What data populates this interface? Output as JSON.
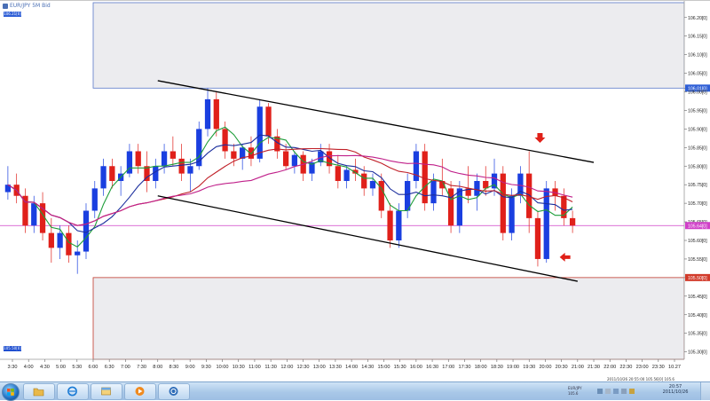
{
  "window": {
    "title": "EUR/JPY 5M Bid",
    "badge_top": "106.21[0]",
    "badge_bottom": "105.50[0]"
  },
  "chart_data": {
    "type": "candlestick",
    "symbol": "EUR/JPY",
    "yticks": [
      "106.20[0]",
      "106.15[0]",
      "106.10[0]",
      "106.05[0]",
      "106.01[0]",
      "106.00[0]",
      "105.95[0]",
      "105.90[0]",
      "105.85[0]",
      "105.80[0]",
      "105.75[0]",
      "105.70[0]",
      "105.65[0]",
      "105.60[0]",
      "105.55[0]",
      "105.50[0]",
      "105.45[0]",
      "105.40[0]",
      "105.35[0]",
      "105.30[0]"
    ],
    "yvalues": [
      106.2,
      106.15,
      106.1,
      106.05,
      106.01,
      106.0,
      105.95,
      105.9,
      105.85,
      105.8,
      105.75,
      105.7,
      105.65,
      105.6,
      105.55,
      105.5,
      105.45,
      105.4,
      105.35,
      105.3
    ],
    "ylim": [
      105.28,
      106.24
    ],
    "xticks": [
      "3:30",
      "4:00",
      "4:30",
      "5:00",
      "5:30",
      "6:00",
      "6:30",
      "7:00",
      "7:30",
      "8:00",
      "8:30",
      "9:00",
      "9:30",
      "10:00",
      "10:30",
      "11:00",
      "11:30",
      "12:00",
      "12:30",
      "13:00",
      "13:30",
      "14:00",
      "14:30",
      "15:00",
      "15:30",
      "16:00",
      "16:30",
      "17:00",
      "17:30",
      "18:00",
      "18:30",
      "19:00",
      "19:30",
      "20:00",
      "20:30",
      "21:00",
      "21:30",
      "22:00",
      "22:30",
      "23:00",
      "23:30",
      "10.27"
    ],
    "current_price": "105.64[0]",
    "current_value": 105.64,
    "top_level": 106.01,
    "bottom_level": 105.5,
    "trend_channel": {
      "upper": {
        "start": [
          "8:00",
          106.03
        ],
        "end": [
          "21:30",
          105.81
        ]
      },
      "lower": {
        "start": [
          "8:00",
          105.72
        ],
        "end": [
          "21:00",
          105.49
        ]
      }
    },
    "series": [
      {
        "name": "",
        "color": "#1f9e3a",
        "type": "moving-average"
      },
      {
        "name": "",
        "color": "#1c2f9e",
        "type": "moving-average"
      },
      {
        "name": "",
        "color": "#c02028",
        "type": "moving-average"
      },
      {
        "name": "",
        "color": "#c0208a",
        "type": "moving-average"
      }
    ],
    "candles": [
      [
        105.73,
        105.8,
        105.71,
        105.75
      ],
      [
        105.75,
        105.78,
        105.7,
        105.72
      ],
      [
        105.72,
        105.74,
        105.62,
        105.64
      ],
      [
        105.64,
        105.72,
        105.62,
        105.7
      ],
      [
        105.7,
        105.73,
        105.6,
        105.62
      ],
      [
        105.62,
        105.66,
        105.54,
        105.58
      ],
      [
        105.58,
        105.64,
        105.55,
        105.62
      ],
      [
        105.62,
        105.64,
        105.54,
        105.56
      ],
      [
        105.56,
        105.6,
        105.51,
        105.57
      ],
      [
        105.57,
        105.7,
        105.55,
        105.68
      ],
      [
        105.68,
        105.76,
        105.66,
        105.74
      ],
      [
        105.74,
        105.82,
        105.72,
        105.8
      ],
      [
        105.8,
        105.82,
        105.74,
        105.76
      ],
      [
        105.76,
        105.8,
        105.72,
        105.78
      ],
      [
        105.78,
        105.86,
        105.77,
        105.84
      ],
      [
        105.84,
        105.86,
        105.78,
        105.8
      ],
      [
        105.8,
        105.84,
        105.73,
        105.76
      ],
      [
        105.76,
        105.82,
        105.74,
        105.8
      ],
      [
        105.8,
        105.86,
        105.78,
        105.84
      ],
      [
        105.84,
        105.88,
        105.8,
        105.82
      ],
      [
        105.82,
        105.86,
        105.76,
        105.78
      ],
      [
        105.78,
        105.82,
        105.73,
        105.8
      ],
      [
        105.8,
        105.92,
        105.79,
        105.9
      ],
      [
        105.9,
        106.01,
        105.88,
        105.98
      ],
      [
        105.98,
        106.0,
        105.88,
        105.9
      ],
      [
        105.9,
        105.92,
        105.82,
        105.84
      ],
      [
        105.84,
        105.86,
        105.8,
        105.82
      ],
      [
        105.82,
        105.86,
        105.79,
        105.85
      ],
      [
        105.85,
        105.88,
        105.8,
        105.82
      ],
      [
        105.82,
        105.98,
        105.81,
        105.96
      ],
      [
        105.96,
        105.97,
        105.86,
        105.88
      ],
      [
        105.88,
        105.9,
        105.82,
        105.84
      ],
      [
        105.84,
        105.86,
        105.79,
        105.8
      ],
      [
        105.8,
        105.84,
        105.78,
        105.83
      ],
      [
        105.83,
        105.84,
        105.76,
        105.78
      ],
      [
        105.78,
        105.82,
        105.76,
        105.81
      ],
      [
        105.81,
        105.86,
        105.8,
        105.84
      ],
      [
        105.84,
        105.86,
        105.78,
        105.8
      ],
      [
        105.8,
        105.83,
        105.74,
        105.76
      ],
      [
        105.76,
        105.8,
        105.74,
        105.79
      ],
      [
        105.79,
        105.82,
        105.76,
        105.78
      ],
      [
        105.78,
        105.8,
        105.72,
        105.74
      ],
      [
        105.74,
        105.78,
        105.72,
        105.76
      ],
      [
        105.76,
        105.78,
        105.66,
        105.68
      ],
      [
        105.68,
        105.7,
        105.58,
        105.6
      ],
      [
        105.6,
        105.7,
        105.58,
        105.68
      ],
      [
        105.68,
        105.78,
        105.66,
        105.76
      ],
      [
        105.76,
        105.86,
        105.74,
        105.84
      ],
      [
        105.84,
        105.86,
        105.68,
        105.7
      ],
      [
        105.7,
        105.78,
        105.68,
        105.76
      ],
      [
        105.76,
        105.82,
        105.72,
        105.74
      ],
      [
        105.74,
        105.76,
        105.62,
        105.64
      ],
      [
        105.64,
        105.76,
        105.62,
        105.74
      ],
      [
        105.74,
        105.8,
        105.7,
        105.72
      ],
      [
        105.72,
        105.78,
        105.68,
        105.76
      ],
      [
        105.76,
        105.8,
        105.72,
        105.74
      ],
      [
        105.74,
        105.82,
        105.72,
        105.78
      ],
      [
        105.78,
        105.8,
        105.6,
        105.62
      ],
      [
        105.62,
        105.74,
        105.6,
        105.72
      ],
      [
        105.72,
        105.8,
        105.7,
        105.78
      ],
      [
        105.78,
        105.84,
        105.62,
        105.66
      ],
      [
        105.66,
        105.68,
        105.53,
        105.55
      ],
      [
        105.55,
        105.76,
        105.54,
        105.74
      ],
      [
        105.74,
        105.76,
        105.68,
        105.72
      ],
      [
        105.72,
        105.74,
        105.64,
        105.66
      ],
      [
        105.66,
        105.68,
        105.62,
        105.64
      ]
    ]
  },
  "status": {
    "line": "2011/10/26 20:55:00  105.56[0]  105.6"
  },
  "taskbar": {
    "tray_line1": "EUR/JPY",
    "tray_line2": "105.6",
    "clock_time": "20:57",
    "clock_date": "2011/10/26"
  }
}
